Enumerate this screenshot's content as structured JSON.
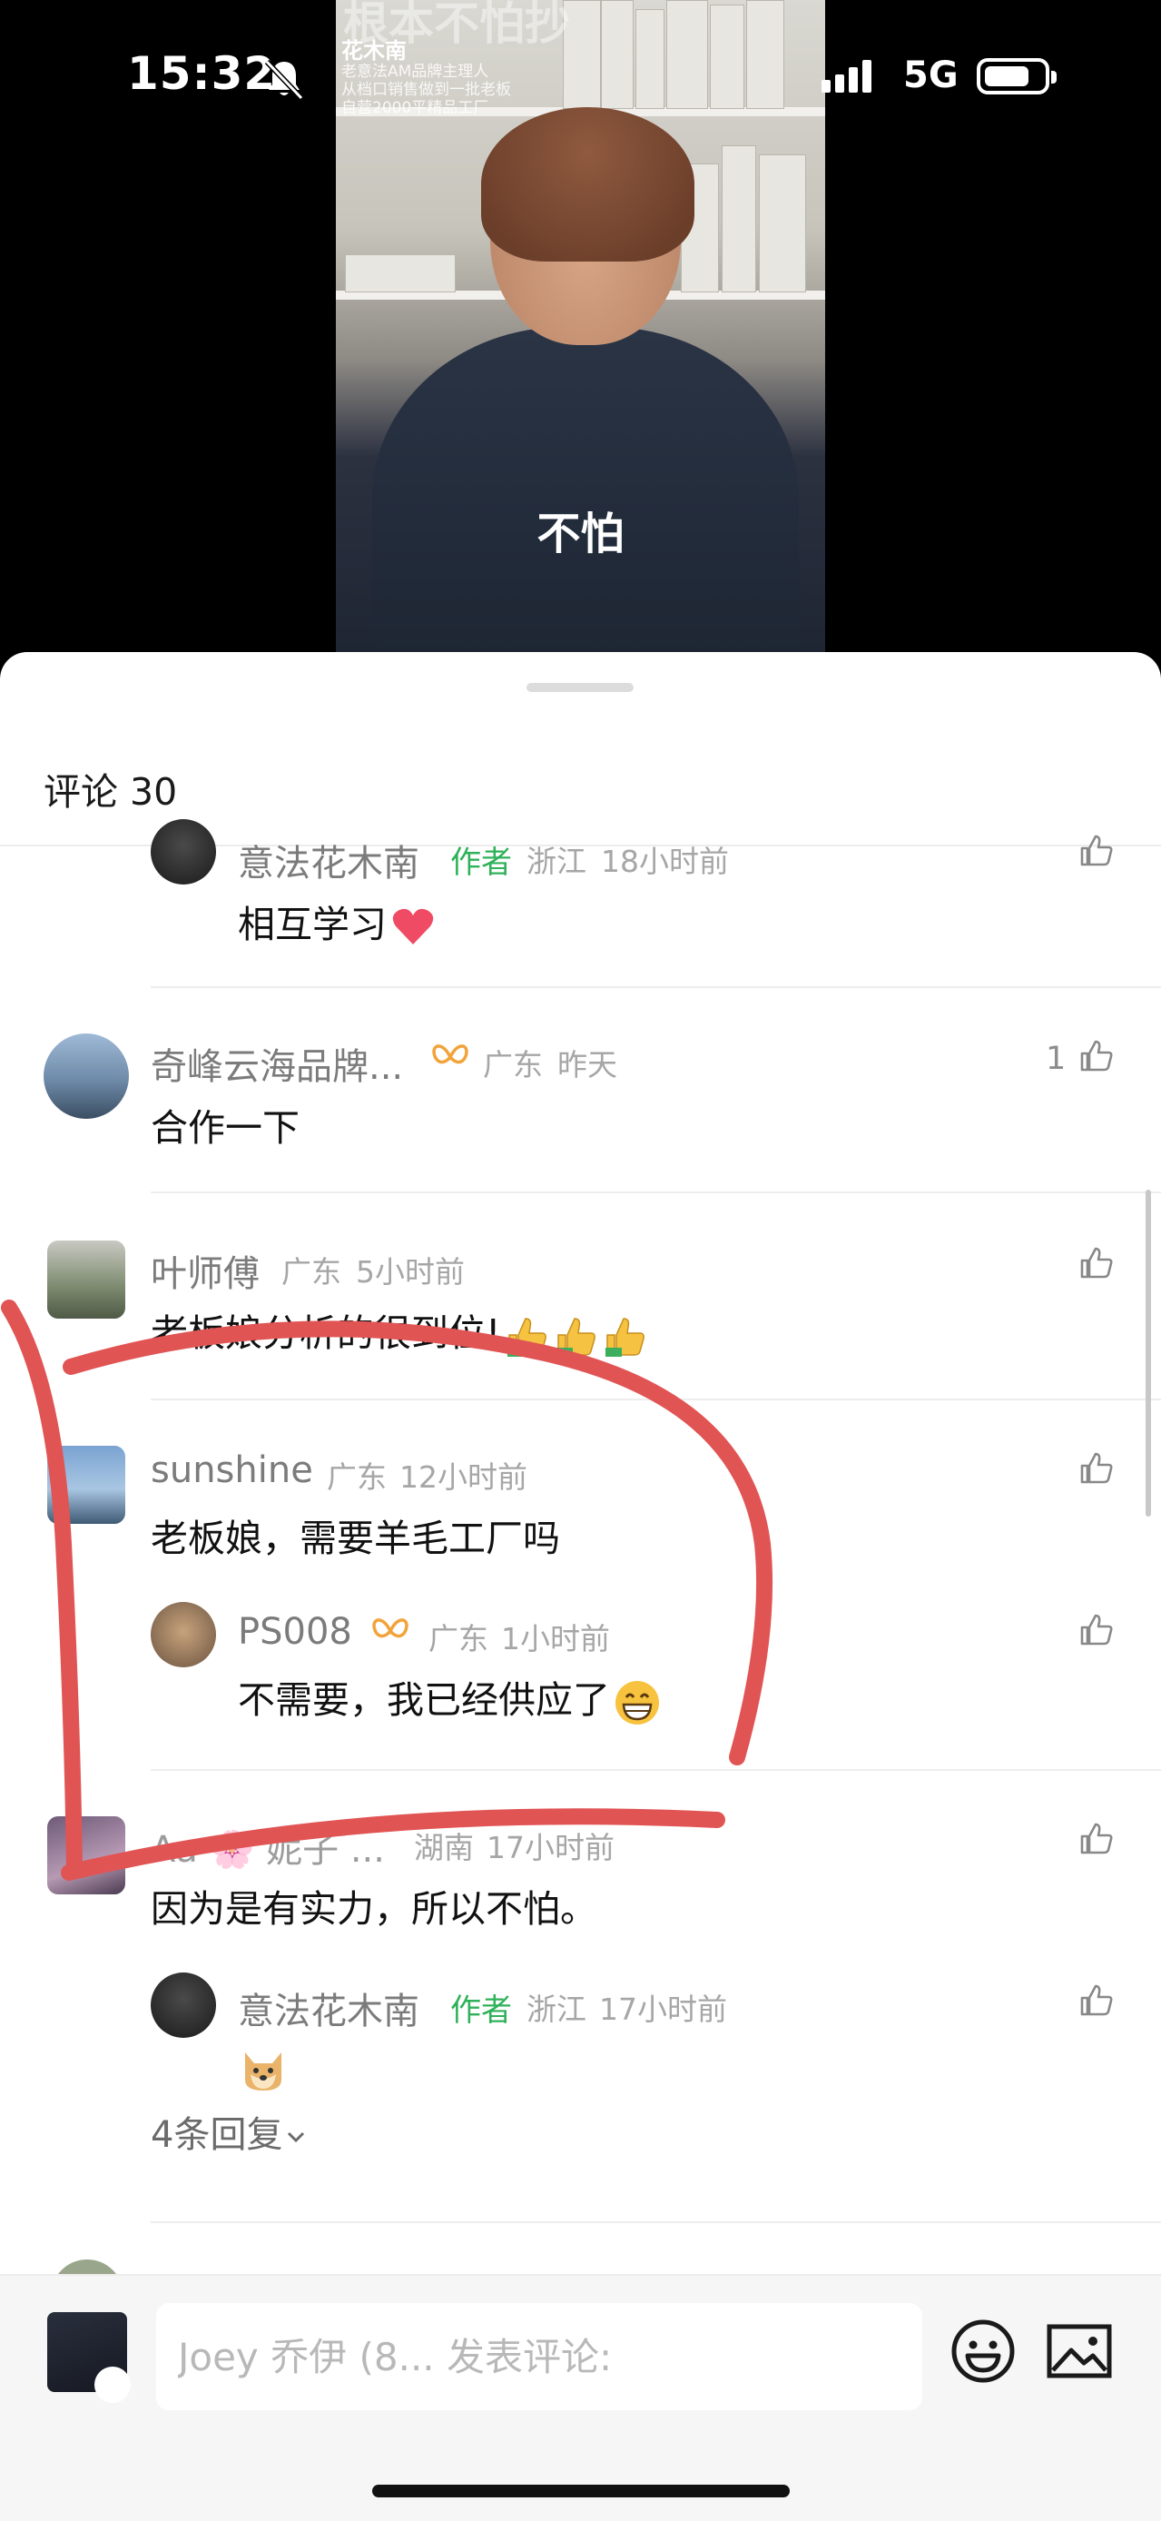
{
  "status_bar": {
    "time": "15:32",
    "network": "5G"
  },
  "video": {
    "overlay_title": "根本不怕抄",
    "overlay_name": "花木南",
    "overlay_lines": [
      "老意法AM品牌主理人",
      "从档口销售做到一批老板",
      "自营2000平精品工厂"
    ],
    "subtitle": "不怕"
  },
  "comments_header": {
    "label": "评论 30"
  },
  "comments": [
    {
      "name": "意法花木南",
      "author_tag": "作者",
      "location": "浙江",
      "time": "18小时前",
      "text": "相互学习",
      "emoji": "heart"
    },
    {
      "name": "奇峰云海品牌...",
      "location": "广东",
      "time": "昨天",
      "text": "合作一下",
      "likes": "1"
    },
    {
      "name": "叶师傅",
      "location": "广东",
      "time": "5小时前",
      "text": "老板娘分析的很到位!",
      "emoji": "thumbs-up x3"
    },
    {
      "name": "sunshine",
      "location": "广东",
      "time": "12小时前",
      "text": "老板娘，需要羊毛工厂吗"
    },
    {
      "name": "PS008",
      "location": "广东",
      "time": "1小时前",
      "text": "不需要，我已经供应了",
      "emoji": "grin"
    },
    {
      "name": "Aa 🌸 妮子 ...",
      "location": "湖南",
      "time": "17小时前",
      "text": "因为是有实力，所以不怕。"
    },
    {
      "name": "意法花木南",
      "author_tag": "作者",
      "location": "浙江",
      "time": "17小时前",
      "emoji": "doge"
    }
  ],
  "reply_more": "4条回复",
  "input": {
    "placeholder": "Joey 乔伊 (8... 发表评论:"
  },
  "colors": {
    "author_green": "#2fb15a",
    "annotation_red": "#e15454",
    "vip_orange": "#f2a33a"
  },
  "icons": [
    "bell-slash-icon",
    "signal-icon",
    "battery-icon",
    "like-icon",
    "vip-badge-icon",
    "chevron-down-icon",
    "emoji-icon",
    "image-icon"
  ]
}
